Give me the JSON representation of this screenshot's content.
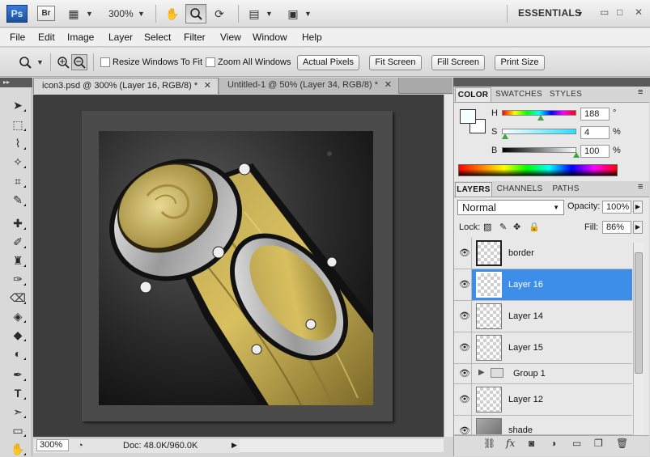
{
  "appbar": {
    "logo": "Ps",
    "bridge": "Br",
    "zoom": "300%",
    "workspace": "ESSENTIALS",
    "icons": [
      "screen-mode-icon",
      "hand-icon",
      "zoom-icon",
      "rotate-view-icon",
      "arrange-documents-icon",
      "screen-icon"
    ]
  },
  "menu": [
    "File",
    "Edit",
    "Image",
    "Layer",
    "Select",
    "Filter",
    "View",
    "Window",
    "Help"
  ],
  "options": {
    "resize_windows": "Resize Windows To Fit",
    "zoom_all": "Zoom All Windows",
    "actual_pixels": "Actual Pixels",
    "fit_screen": "Fit Screen",
    "fill_screen": "Fill Screen",
    "print_size": "Print Size"
  },
  "tabs": [
    {
      "label": "icon3.psd @ 300% (Layer 16, RGB/8) *",
      "active": true
    },
    {
      "label": "Untitled-1 @ 50% (Layer 34, RGB/8) *",
      "active": false
    }
  ],
  "status": {
    "zoom": "300%",
    "doc": "Doc: 48.0K/960.0K"
  },
  "color_panel": {
    "tabs": [
      "COLOR",
      "SWATCHES",
      "STYLES"
    ],
    "h_label": "H",
    "h_value": "188",
    "h_unit": "°",
    "s_label": "S",
    "s_value": "4",
    "s_unit": "%",
    "b_label": "B",
    "b_value": "100",
    "b_unit": "%"
  },
  "layers_panel": {
    "tabs": [
      "LAYERS",
      "CHANNELS",
      "PATHS"
    ],
    "blend_mode": "Normal",
    "opacity_label": "Opacity:",
    "opacity": "100%",
    "lock_label": "Lock:",
    "fill_label": "Fill:",
    "fill": "86%",
    "layers": [
      {
        "name": "border",
        "selected": false,
        "type": "layer"
      },
      {
        "name": "Layer 16",
        "selected": true,
        "type": "layer"
      },
      {
        "name": "Layer 14",
        "selected": false,
        "type": "layer"
      },
      {
        "name": "Layer 15",
        "selected": false,
        "type": "layer"
      },
      {
        "name": "Group 1",
        "selected": false,
        "type": "group"
      },
      {
        "name": "Layer 12",
        "selected": false,
        "type": "layer"
      },
      {
        "name": "shade",
        "selected": false,
        "type": "layer"
      }
    ]
  },
  "colors": {
    "selection": "#3d8ee8",
    "canvas_bg": "#3d3d3d",
    "ps_blue": "#1c4f9c"
  }
}
